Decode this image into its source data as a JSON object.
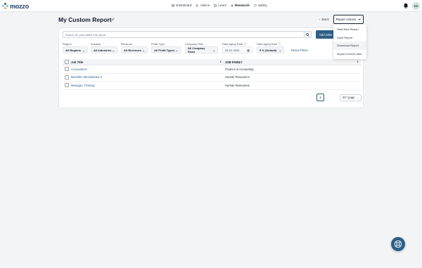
{
  "brand": {
    "name": "mozzo"
  },
  "nav": {
    "links": [
      {
        "label": "Dashboard",
        "icon": "dashboard-icon"
      },
      {
        "label": "Advice",
        "icon": "advice-icon"
      },
      {
        "label": "Learn",
        "icon": "learn-icon"
      },
      {
        "label": "Research",
        "icon": "research-icon",
        "active": true
      },
      {
        "label": "Safety",
        "icon": "safety-icon"
      }
    ],
    "avatar_initials": "DS"
  },
  "header": {
    "title": "My Custom Report",
    "back_label": "Back",
    "report_actions_label": "Report Actions"
  },
  "search": {
    "placeholder": "Search for jobs within this report"
  },
  "add_jobs_label": "Add Jobs",
  "filters": [
    {
      "label": "Region",
      "value": "All Regions"
    },
    {
      "label": "Industry",
      "value": "All Industries"
    },
    {
      "label": "Revenue",
      "value": "All Revenues"
    },
    {
      "label": "Profit Type",
      "value": "All Profit Types"
    },
    {
      "label": "Company Size",
      "value": "All Company Sizes"
    },
    {
      "label": "Data Aging Rate",
      "value": "03-22-2024"
    },
    {
      "label": "Data Aging Rate",
      "value": "5 % (Default)"
    }
  ],
  "reset_filters_label": "Reset Filters",
  "table": {
    "columns": [
      "Job Title",
      "JOB FAMILY"
    ],
    "rows": [
      {
        "title": "Accountant I",
        "family": "Finance & Accounting"
      },
      {
        "title": "Benefits Administrator II",
        "family": "Human Resources"
      },
      {
        "title": "Manager, Training",
        "family": "Human Resources"
      }
    ]
  },
  "pagination": {
    "current_page": "1",
    "page_size": "20 / page"
  },
  "report_actions_menu": [
    "Start New Report",
    "Save Report",
    "Download Report",
    "Import Current Jobs"
  ],
  "colors": {
    "primary": "#2d5f86",
    "background": "#f3f4f6",
    "brand_text": "#1e3a5f"
  }
}
